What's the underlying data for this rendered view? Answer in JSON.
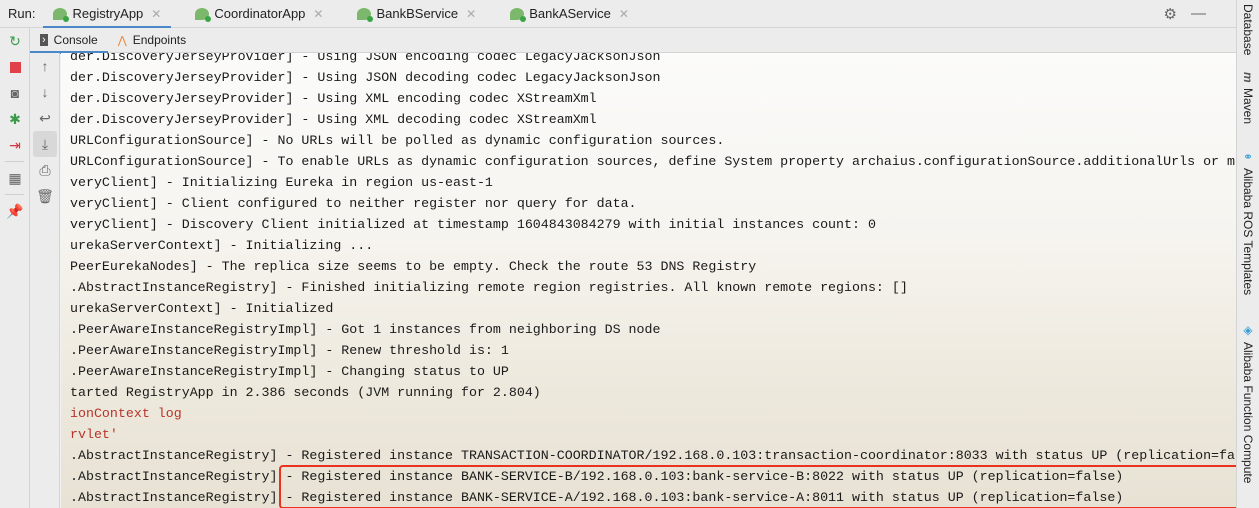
{
  "run_label": "Run:",
  "run_tabs": [
    {
      "label": "RegistryApp",
      "active": true
    },
    {
      "label": "CoordinatorApp"
    },
    {
      "label": "BankBService"
    },
    {
      "label": "BankAService"
    }
  ],
  "sub_tabs": [
    {
      "label": "Console",
      "icon": "console-icon"
    },
    {
      "label": "Endpoints",
      "icon": "endpoints-icon"
    }
  ],
  "right_tools": [
    "Database",
    "Maven",
    "Alibaba ROS Templates",
    "Alibaba Function Compute"
  ],
  "console_lines": [
    {
      "text": "der.DiscoveryJerseyProvider] - Using JSON encoding codec LegacyJacksonJson"
    },
    {
      "text": "der.DiscoveryJerseyProvider] - Using JSON decoding codec LegacyJacksonJson"
    },
    {
      "text": "der.DiscoveryJerseyProvider] - Using XML encoding codec XStreamXml"
    },
    {
      "text": "der.DiscoveryJerseyProvider] - Using XML decoding codec XStreamXml"
    },
    {
      "text": "URLConfigurationSource] - No URLs will be polled as dynamic configuration sources."
    },
    {
      "text": "URLConfigurationSource] - To enable URLs as dynamic configuration sources, define System property archaius.configurationSource.additionalUrls or m"
    },
    {
      "text": "veryClient] - Initializing Eureka in region us-east-1"
    },
    {
      "text": "veryClient] - Client configured to neither register nor query for data."
    },
    {
      "text": "veryClient] - Discovery Client initialized at timestamp 1604843084279 with initial instances count: 0"
    },
    {
      "text": "urekaServerContext] - Initializing ..."
    },
    {
      "text": "PeerEurekaNodes] - The replica size seems to be empty. Check the route 53 DNS Registry"
    },
    {
      "text": ".AbstractInstanceRegistry] - Finished initializing remote region registries. All known remote regions: []"
    },
    {
      "text": "urekaServerContext] - Initialized"
    },
    {
      "text": ".PeerAwareInstanceRegistryImpl] - Got 1 instances from neighboring DS node"
    },
    {
      "text": ".PeerAwareInstanceRegistryImpl] - Renew threshold is: 1"
    },
    {
      "text": ".PeerAwareInstanceRegistryImpl] - Changing status to UP"
    },
    {
      "text": "tarted RegistryApp in 2.386 seconds (JVM running for 2.804)"
    },
    {
      "text": "ionContext log",
      "red": true
    },
    {
      "text": "rvlet'",
      "red": true
    },
    {
      "text": ".AbstractInstanceRegistry] - Registered instance TRANSACTION-COORDINATOR/192.168.0.103:transaction-coordinator:8033 with status UP (replication=fa"
    },
    {
      "text": ".AbstractInstanceRegistry] - Registered instance BANK-SERVICE-B/192.168.0.103:bank-service-B:8022 with status UP (replication=false)"
    },
    {
      "text": ".AbstractInstanceRegistry] - Registered instance BANK-SERVICE-A/192.168.0.103:bank-service-A:8011 with status UP (replication=false)"
    }
  ]
}
